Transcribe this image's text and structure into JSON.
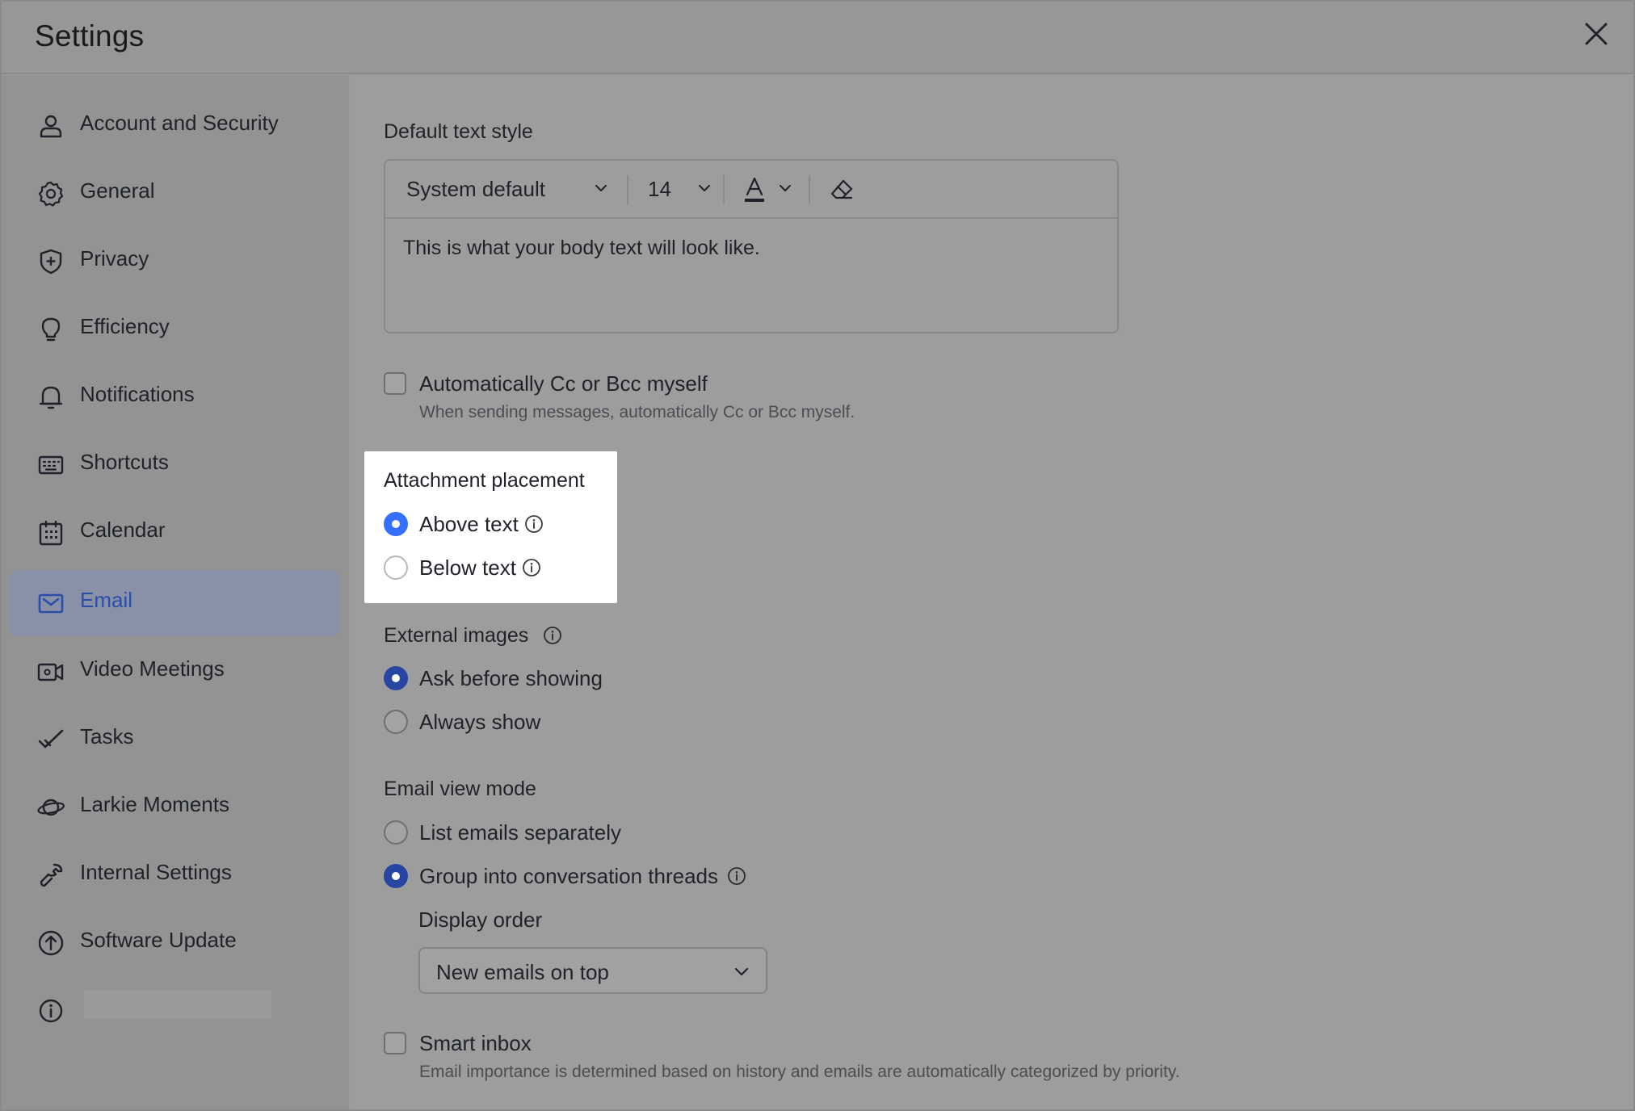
{
  "window": {
    "title": "Settings"
  },
  "sidebar": {
    "items": [
      {
        "label": "Account and Security",
        "icon": "person-icon"
      },
      {
        "label": "General",
        "icon": "gear-icon"
      },
      {
        "label": "Privacy",
        "icon": "shield-icon"
      },
      {
        "label": "Efficiency",
        "icon": "lightbulb-icon"
      },
      {
        "label": "Notifications",
        "icon": "bell-icon"
      },
      {
        "label": "Shortcuts",
        "icon": "keyboard-icon"
      },
      {
        "label": "Calendar",
        "icon": "calendar-icon"
      },
      {
        "label": "Email",
        "icon": "mail-icon",
        "active": true
      },
      {
        "label": "Video Meetings",
        "icon": "video-icon"
      },
      {
        "label": "Tasks",
        "icon": "check-icon"
      },
      {
        "label": "Larkie Moments",
        "icon": "planet-icon"
      },
      {
        "label": "Internal Settings",
        "icon": "wrench-icon"
      },
      {
        "label": "Software Update",
        "icon": "upload-arrow-icon"
      }
    ],
    "about_icon": "info-icon"
  },
  "email": {
    "text_style": {
      "title": "Default text style",
      "font": "System default",
      "size": "14",
      "preview": "This is what your body text will look like."
    },
    "auto_cc": {
      "label": "Automatically Cc or Bcc myself",
      "description": "When sending messages, automatically Cc or Bcc myself.",
      "checked": false
    },
    "attachment_placement": {
      "title": "Attachment placement",
      "options": [
        "Above text",
        "Below text"
      ],
      "selected": "Above text"
    },
    "external_images": {
      "title": "External images",
      "options": [
        "Ask before showing",
        "Always show"
      ],
      "selected": "Ask before showing"
    },
    "view_mode": {
      "title": "Email view mode",
      "options": [
        "List emails separately",
        "Group into conversation threads"
      ],
      "selected": "Group into conversation threads",
      "display_order_label": "Display order",
      "display_order_value": "New emails on top"
    },
    "smart_inbox": {
      "label": "Smart inbox",
      "description": "Email importance is determined based on history and emails are automatically categorized by priority.",
      "checked": false
    }
  },
  "colors": {
    "accent": "#3370ff",
    "accent_dimmed": "#2745a3",
    "active_nav_bg": "#8891a8"
  }
}
